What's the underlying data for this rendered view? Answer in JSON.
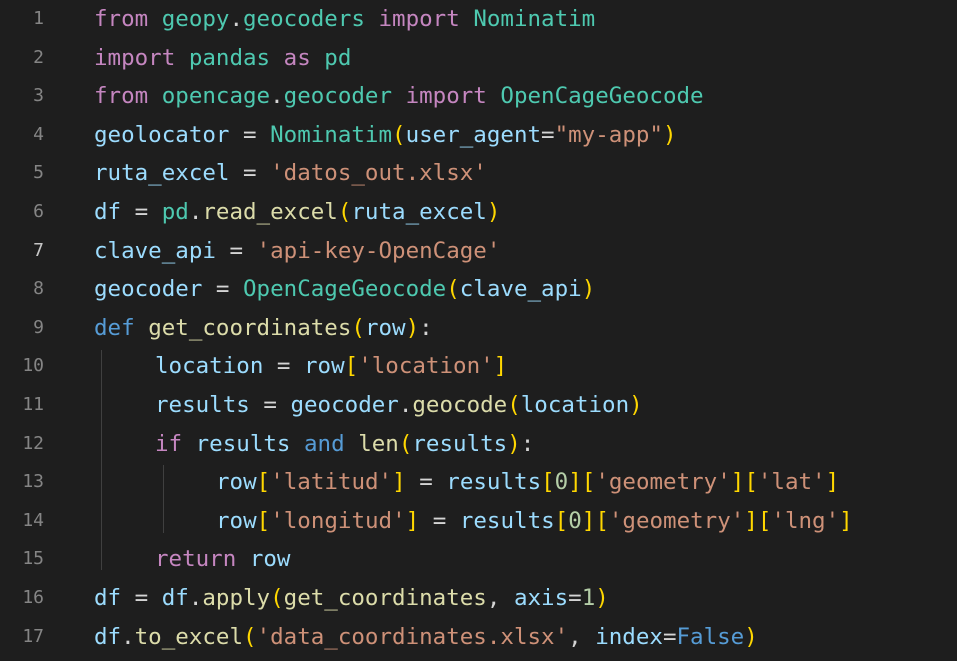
{
  "colors": {
    "background": "#1e1e1e",
    "line_number": "#858585",
    "line_number_active": "#c6c6c6",
    "keyword": "#c586c0",
    "def_keyword": "#569cd6",
    "function": "#dcdcaa",
    "class": "#4ec9b0",
    "variable": "#9cdcfe",
    "string": "#ce9178",
    "number": "#b5cea8",
    "bracket_level1": "#ffd700",
    "bracket_level2": "#da70d6"
  },
  "active_line": 7,
  "lines": [
    {
      "number": "1",
      "tokens": [
        [
          "from",
          "kw"
        ],
        [
          " ",
          "plain"
        ],
        [
          "geopy",
          "cls"
        ],
        [
          ".",
          "plain"
        ],
        [
          "geocoders",
          "cls"
        ],
        [
          " ",
          "plain"
        ],
        [
          "import",
          "kw"
        ],
        [
          " ",
          "plain"
        ],
        [
          "Nominatim",
          "cls"
        ]
      ]
    },
    {
      "number": "2",
      "tokens": [
        [
          "import",
          "kw"
        ],
        [
          " ",
          "plain"
        ],
        [
          "pandas",
          "cls"
        ],
        [
          " ",
          "plain"
        ],
        [
          "as",
          "kw"
        ],
        [
          " ",
          "plain"
        ],
        [
          "pd",
          "cls"
        ]
      ]
    },
    {
      "number": "3",
      "tokens": [
        [
          "from",
          "kw"
        ],
        [
          " ",
          "plain"
        ],
        [
          "opencage",
          "cls"
        ],
        [
          ".",
          "plain"
        ],
        [
          "geocoder",
          "cls"
        ],
        [
          " ",
          "plain"
        ],
        [
          "import",
          "kw"
        ],
        [
          " ",
          "plain"
        ],
        [
          "OpenCageGeocode",
          "cls"
        ]
      ]
    },
    {
      "number": "4",
      "tokens": [
        [
          "geolocator",
          "var"
        ],
        [
          " = ",
          "plain"
        ],
        [
          "Nominatim",
          "cls"
        ],
        [
          "(",
          "br1"
        ],
        [
          "user_agent",
          "var"
        ],
        [
          "=",
          "plain"
        ],
        [
          "\"my-app\"",
          "str"
        ],
        [
          ")",
          "br1"
        ]
      ]
    },
    {
      "number": "5",
      "tokens": [
        [
          "ruta_excel",
          "var"
        ],
        [
          " = ",
          "plain"
        ],
        [
          "'datos_out.xlsx'",
          "str"
        ]
      ]
    },
    {
      "number": "6",
      "tokens": [
        [
          "df",
          "var"
        ],
        [
          " = ",
          "plain"
        ],
        [
          "pd",
          "cls"
        ],
        [
          ".",
          "plain"
        ],
        [
          "read_excel",
          "fn"
        ],
        [
          "(",
          "br1"
        ],
        [
          "ruta_excel",
          "var"
        ],
        [
          ")",
          "br1"
        ]
      ]
    },
    {
      "number": "7",
      "tokens": [
        [
          "clave_api",
          "var"
        ],
        [
          " = ",
          "plain"
        ],
        [
          "'api-key-OpenCage'",
          "str"
        ]
      ]
    },
    {
      "number": "8",
      "tokens": [
        [
          "geocoder",
          "var"
        ],
        [
          " = ",
          "plain"
        ],
        [
          "OpenCageGeocode",
          "cls"
        ],
        [
          "(",
          "br1"
        ],
        [
          "clave_api",
          "var"
        ],
        [
          ")",
          "br1"
        ]
      ]
    },
    {
      "number": "9",
      "tokens": [
        [
          "def",
          "kd"
        ],
        [
          " ",
          "plain"
        ],
        [
          "get_coordinates",
          "fn"
        ],
        [
          "(",
          "br1"
        ],
        [
          "row",
          "var"
        ],
        [
          ")",
          "br1"
        ],
        [
          ":",
          "plain"
        ]
      ]
    },
    {
      "number": "10",
      "indent": 1,
      "tokens": [
        [
          "location",
          "var"
        ],
        [
          " = ",
          "plain"
        ],
        [
          "row",
          "var"
        ],
        [
          "[",
          "br1"
        ],
        [
          "'location'",
          "str"
        ],
        [
          "]",
          "br1"
        ]
      ]
    },
    {
      "number": "11",
      "indent": 1,
      "tokens": [
        [
          "results",
          "var"
        ],
        [
          " = ",
          "plain"
        ],
        [
          "geocoder",
          "var"
        ],
        [
          ".",
          "plain"
        ],
        [
          "geocode",
          "fn"
        ],
        [
          "(",
          "br1"
        ],
        [
          "location",
          "var"
        ],
        [
          ")",
          "br1"
        ]
      ]
    },
    {
      "number": "12",
      "indent": 1,
      "tokens": [
        [
          "if",
          "kw"
        ],
        [
          " ",
          "plain"
        ],
        [
          "results",
          "var"
        ],
        [
          " ",
          "plain"
        ],
        [
          "and",
          "kd"
        ],
        [
          " ",
          "plain"
        ],
        [
          "len",
          "fn"
        ],
        [
          "(",
          "br1"
        ],
        [
          "results",
          "var"
        ],
        [
          ")",
          "br1"
        ],
        [
          ":",
          "plain"
        ]
      ]
    },
    {
      "number": "13",
      "indent": 2,
      "tokens": [
        [
          "row",
          "var"
        ],
        [
          "[",
          "br1"
        ],
        [
          "'latitud'",
          "str"
        ],
        [
          "]",
          "br1"
        ],
        [
          " = ",
          "plain"
        ],
        [
          "results",
          "var"
        ],
        [
          "[",
          "br1"
        ],
        [
          "0",
          "num"
        ],
        [
          "]",
          "br1"
        ],
        [
          "[",
          "br1"
        ],
        [
          "'geometry'",
          "str"
        ],
        [
          "]",
          "br1"
        ],
        [
          "[",
          "br1"
        ],
        [
          "'lat'",
          "str"
        ],
        [
          "]",
          "br1"
        ]
      ]
    },
    {
      "number": "14",
      "indent": 2,
      "tokens": [
        [
          "row",
          "var"
        ],
        [
          "[",
          "br1"
        ],
        [
          "'longitud'",
          "str"
        ],
        [
          "]",
          "br1"
        ],
        [
          " = ",
          "plain"
        ],
        [
          "results",
          "var"
        ],
        [
          "[",
          "br1"
        ],
        [
          "0",
          "num"
        ],
        [
          "]",
          "br1"
        ],
        [
          "[",
          "br1"
        ],
        [
          "'geometry'",
          "str"
        ],
        [
          "]",
          "br1"
        ],
        [
          "[",
          "br1"
        ],
        [
          "'lng'",
          "str"
        ],
        [
          "]",
          "br1"
        ]
      ]
    },
    {
      "number": "15",
      "indent": 1,
      "tokens": [
        [
          "return",
          "kw"
        ],
        [
          " ",
          "plain"
        ],
        [
          "row",
          "var"
        ]
      ]
    },
    {
      "number": "16",
      "tokens": [
        [
          "df",
          "var"
        ],
        [
          " = ",
          "plain"
        ],
        [
          "df",
          "var"
        ],
        [
          ".",
          "plain"
        ],
        [
          "apply",
          "fn"
        ],
        [
          "(",
          "br1"
        ],
        [
          "get_coordinates",
          "fn"
        ],
        [
          ", ",
          "plain"
        ],
        [
          "axis",
          "var"
        ],
        [
          "=",
          "plain"
        ],
        [
          "1",
          "num"
        ],
        [
          ")",
          "br1"
        ]
      ]
    },
    {
      "number": "17",
      "tokens": [
        [
          "df",
          "var"
        ],
        [
          ".",
          "plain"
        ],
        [
          "to_excel",
          "fn"
        ],
        [
          "(",
          "br1"
        ],
        [
          "'data_coordinates.xlsx'",
          "str"
        ],
        [
          ", ",
          "plain"
        ],
        [
          "index",
          "var"
        ],
        [
          "=",
          "plain"
        ],
        [
          "False",
          "kd"
        ],
        [
          ")",
          "br1"
        ]
      ]
    }
  ]
}
